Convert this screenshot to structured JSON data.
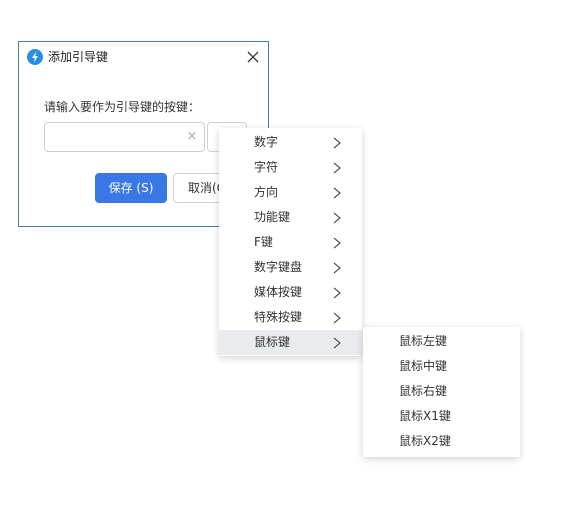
{
  "dialog": {
    "title": "添加引导键",
    "prompt": "请输入要作为引导键的按键：",
    "input_value": "",
    "clear_symbol": "×",
    "save_label": "保存 (S)",
    "cancel_label": "取消(C)",
    "accent_color": "#3a78e8",
    "icon": "lightning-icon"
  },
  "menu": {
    "items": [
      {
        "label": "数字"
      },
      {
        "label": "字符"
      },
      {
        "label": "方向"
      },
      {
        "label": "功能键"
      },
      {
        "label": "F键"
      },
      {
        "label": "数字键盘"
      },
      {
        "label": "媒体按键"
      },
      {
        "label": "特殊按键"
      },
      {
        "label": "鼠标键"
      }
    ],
    "active_item": "鼠标键"
  },
  "submenu": {
    "items": [
      {
        "label": "鼠标左键"
      },
      {
        "label": "鼠标中键"
      },
      {
        "label": "鼠标右键"
      },
      {
        "label": "鼠标X1键"
      },
      {
        "label": "鼠标X2键"
      }
    ]
  }
}
